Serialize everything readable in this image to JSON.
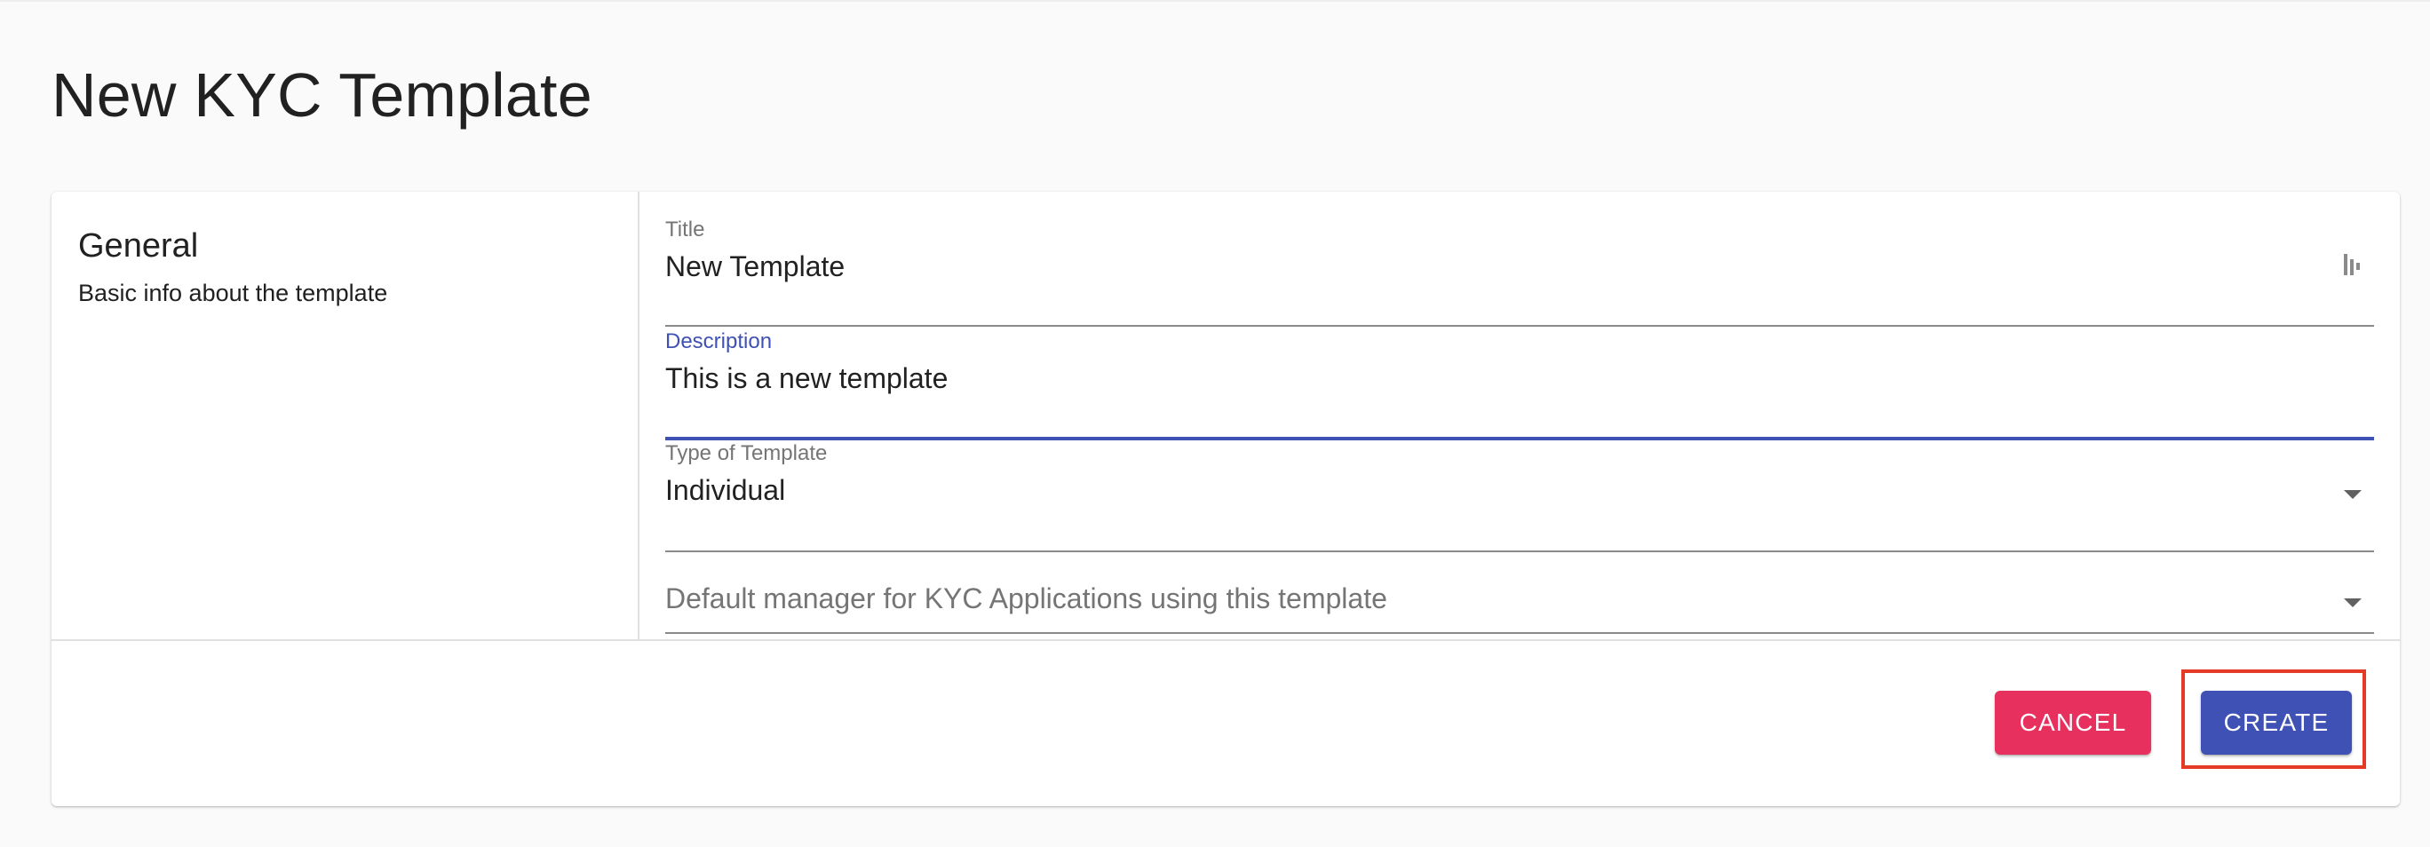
{
  "page": {
    "title": "New KYC Template"
  },
  "general": {
    "section_title": "General",
    "section_subtitle": "Basic info about the template"
  },
  "form": {
    "title": {
      "label": "Title",
      "value": "New Template"
    },
    "description": {
      "label": "Description",
      "value": "This is a new template"
    },
    "type": {
      "label": "Type of Template",
      "value": "Individual"
    },
    "manager": {
      "placeholder": "Default manager for KYC Applications using this template"
    }
  },
  "actions": {
    "cancel_label": "CANCEL",
    "create_label": "CREATE"
  },
  "colors": {
    "primary": "#3f51b5",
    "cancel": "#e8305e",
    "highlight": "#e53a25"
  },
  "icons": {
    "title_field": "password-manager-icon",
    "dropdown": "caret-down-icon"
  }
}
